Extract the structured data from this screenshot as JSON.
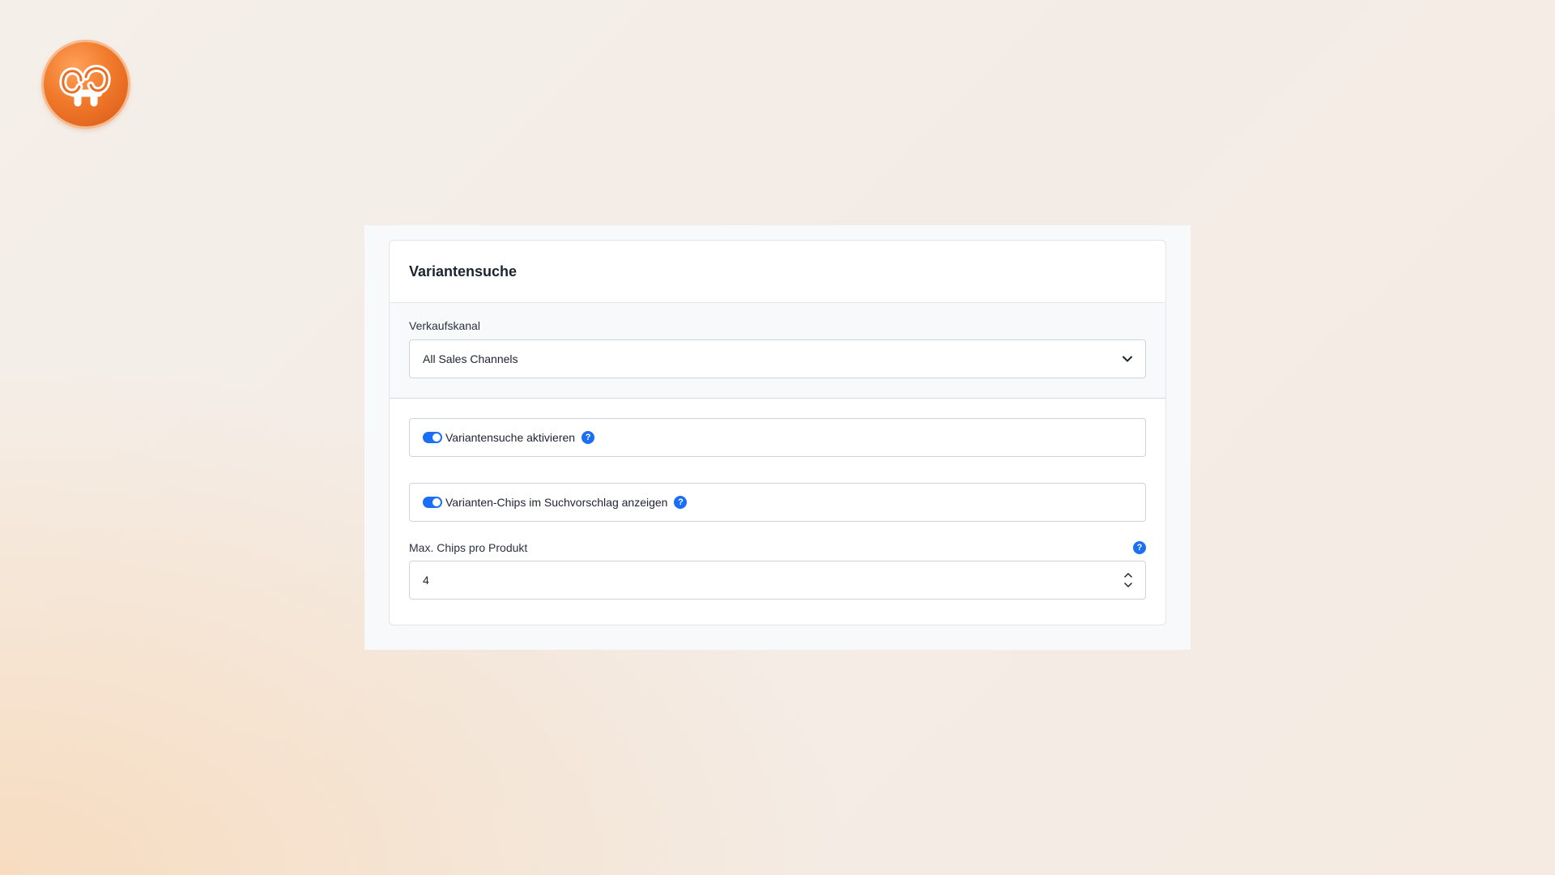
{
  "app": {
    "logo_icon": "xoops-logo-icon"
  },
  "card": {
    "title": "Variantensuche"
  },
  "sales_channel": {
    "label": "Verkaufskanal",
    "selected": "All Sales Channels"
  },
  "toggles": [
    {
      "label": "Variantensuche aktivieren",
      "enabled": true
    },
    {
      "label": "Varianten-Chips im Suchvorschlag anzeigen",
      "enabled": true
    }
  ],
  "max_chips": {
    "label": "Max. Chips pro Produkt",
    "value": "4"
  },
  "help_glyph": "?",
  "colors": {
    "accent": "#1a6ff5",
    "logo": "#f07a2a"
  }
}
